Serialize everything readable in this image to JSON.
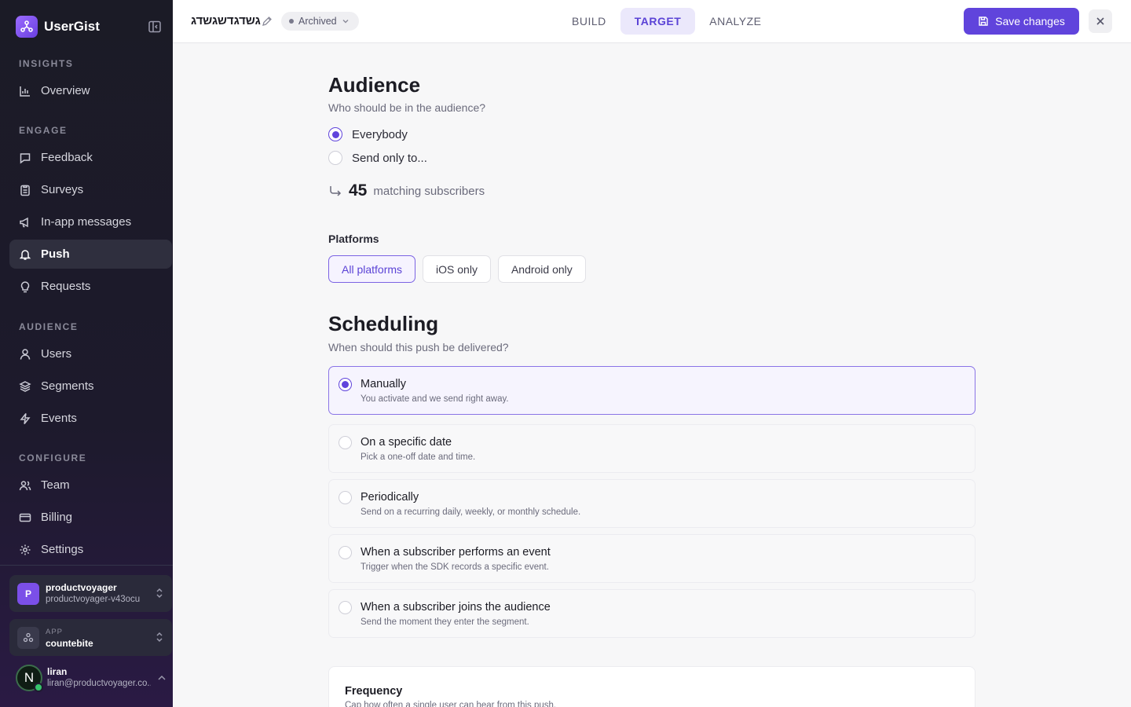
{
  "sidebar": {
    "brand": "UserGist",
    "sections": {
      "insights": "INSIGHTS",
      "engage": "ENGAGE",
      "audience": "AUDIENCE",
      "configure": "CONFIGURE"
    },
    "items": {
      "overview": "Overview",
      "feedback": "Feedback",
      "surveys": "Surveys",
      "in_app": "In-app messages",
      "push": "Push",
      "requests": "Requests",
      "users": "Users",
      "segments": "Segments",
      "events": "Events",
      "team": "Team",
      "billing": "Billing",
      "settings": "Settings"
    },
    "active_item": "Push",
    "org": {
      "badge": "P",
      "name": "productvoyager",
      "id": "productvoyager-v43ocu"
    },
    "app": {
      "caption": "APP",
      "name": "countebite"
    },
    "user": {
      "initial": "N",
      "name": "liran",
      "email": "liran@productvoyager.co..."
    }
  },
  "header": {
    "campaign_name": "גשדגדשגשדג",
    "status": "Archived",
    "tabs": [
      "BUILD",
      "TARGET",
      "ANALYZE"
    ],
    "active_tab": "TARGET",
    "save_label": "Save changes"
  },
  "audience": {
    "title": "Audience",
    "subtitle": "Who should be in the audience?",
    "options": [
      "Everybody",
      "Send only to..."
    ],
    "selected": "Everybody",
    "matching_count": "45",
    "matching_label": "matching subscribers"
  },
  "platforms": {
    "label": "Platforms",
    "options": [
      "All platforms",
      "iOS only",
      "Android only"
    ],
    "selected": "All platforms"
  },
  "scheduling": {
    "title": "Scheduling",
    "subtitle": "When should this push be delivered?",
    "options": [
      {
        "title": "Manually",
        "desc": "You activate and we send right away."
      },
      {
        "title": "On a specific date",
        "desc": "Pick a one-off date and time."
      },
      {
        "title": "Periodically",
        "desc": "Send on a recurring daily, weekly, or monthly schedule."
      },
      {
        "title": "When a subscriber performs an event",
        "desc": "Trigger when the SDK records a specific event."
      },
      {
        "title": "When a subscriber joins the audience",
        "desc": "Send the moment they enter the segment."
      }
    ],
    "selected": "Manually"
  },
  "frequency": {
    "title": "Frequency",
    "desc": "Cap how often a single user can hear from this push."
  },
  "colors": {
    "accent": "#6044dc",
    "sidebar_bg": "#1b1b26",
    "active_tab_bg": "#ebe8fb"
  },
  "icons": {
    "brand": "usergist-logo-icon",
    "overview": "bar-chart-icon",
    "feedback": "chat-bubble-icon",
    "surveys": "clipboard-icon",
    "in_app": "megaphone-icon",
    "push": "bell-icon",
    "requests": "lightbulb-icon",
    "users": "user-icon",
    "segments": "layers-icon",
    "events": "bolt-icon",
    "team": "users-icon",
    "billing": "credit-card-icon",
    "settings": "gear-icon"
  }
}
